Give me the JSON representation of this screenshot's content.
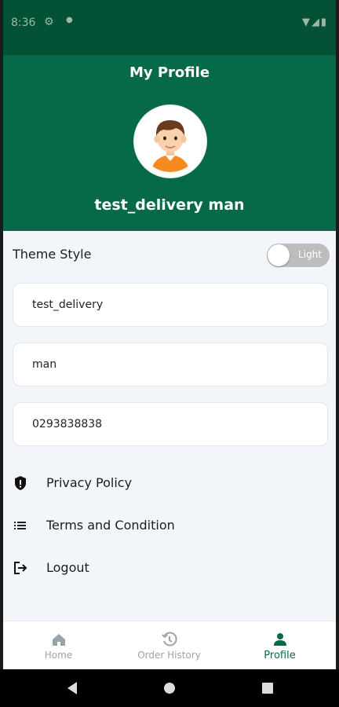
{
  "status_bar": {
    "time": "8:36",
    "icons": [
      "settings-icon",
      "dot-icon",
      "wifi-icon",
      "signal-icon",
      "battery-icon"
    ]
  },
  "header": {
    "title": "My Profile",
    "name": "test_delivery man",
    "background": "#066a4a"
  },
  "theme": {
    "label": "Theme Style",
    "toggle_text": "Light",
    "is_dark": false
  },
  "fields": [
    {
      "value": "test_delivery"
    },
    {
      "value": "man"
    },
    {
      "value": "0293838838"
    }
  ],
  "menu": [
    {
      "label": "Privacy Policy",
      "icon": "shield-icon"
    },
    {
      "label": "Terms and Condition",
      "icon": "list-icon"
    },
    {
      "label": "Logout",
      "icon": "logout-icon"
    }
  ],
  "bottom_nav": {
    "items": [
      {
        "label": "Home",
        "icon": "home-icon",
        "active": false
      },
      {
        "label": "Order History",
        "icon": "history-icon",
        "active": false
      },
      {
        "label": "Profile",
        "icon": "person-icon",
        "active": true
      }
    ],
    "active_color": "#066a4a"
  }
}
